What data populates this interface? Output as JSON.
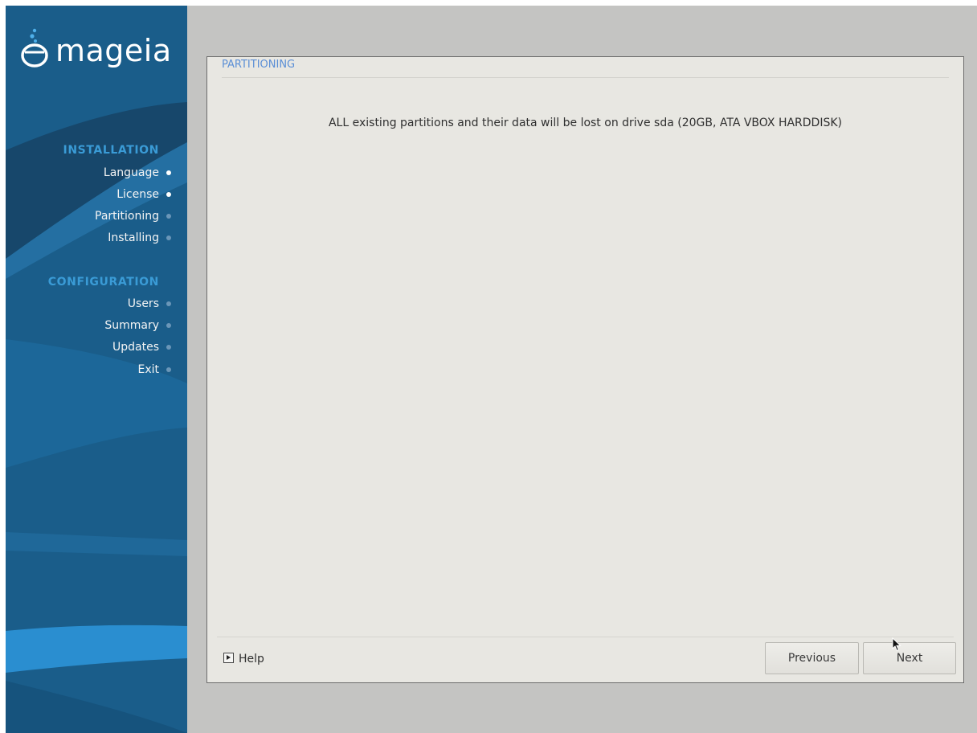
{
  "brand": {
    "logo_text": "mageia"
  },
  "sidebar": {
    "sections": [
      {
        "title": "INSTALLATION",
        "items": [
          {
            "label": "Language",
            "done": true
          },
          {
            "label": "License",
            "done": true
          },
          {
            "label": "Partitioning",
            "done": false
          },
          {
            "label": "Installing",
            "done": false
          }
        ]
      },
      {
        "title": "CONFIGURATION",
        "items": [
          {
            "label": "Users",
            "done": false
          },
          {
            "label": "Summary",
            "done": false
          },
          {
            "label": "Updates",
            "done": false
          },
          {
            "label": "Exit",
            "done": false
          }
        ]
      }
    ]
  },
  "panel": {
    "title": "PARTITIONING",
    "message": "ALL existing partitions and their data will be lost on drive sda (20GB, ATA VBOX HARDDISK)"
  },
  "footer": {
    "help_label": "Help",
    "previous_label": "Previous",
    "next_label": "Next"
  },
  "colors": {
    "sidebar_bg": "#1a5d8a",
    "section_title": "#3a9bd6",
    "panel_bg": "#e8e7e2",
    "panel_title": "#5b8fd6"
  }
}
